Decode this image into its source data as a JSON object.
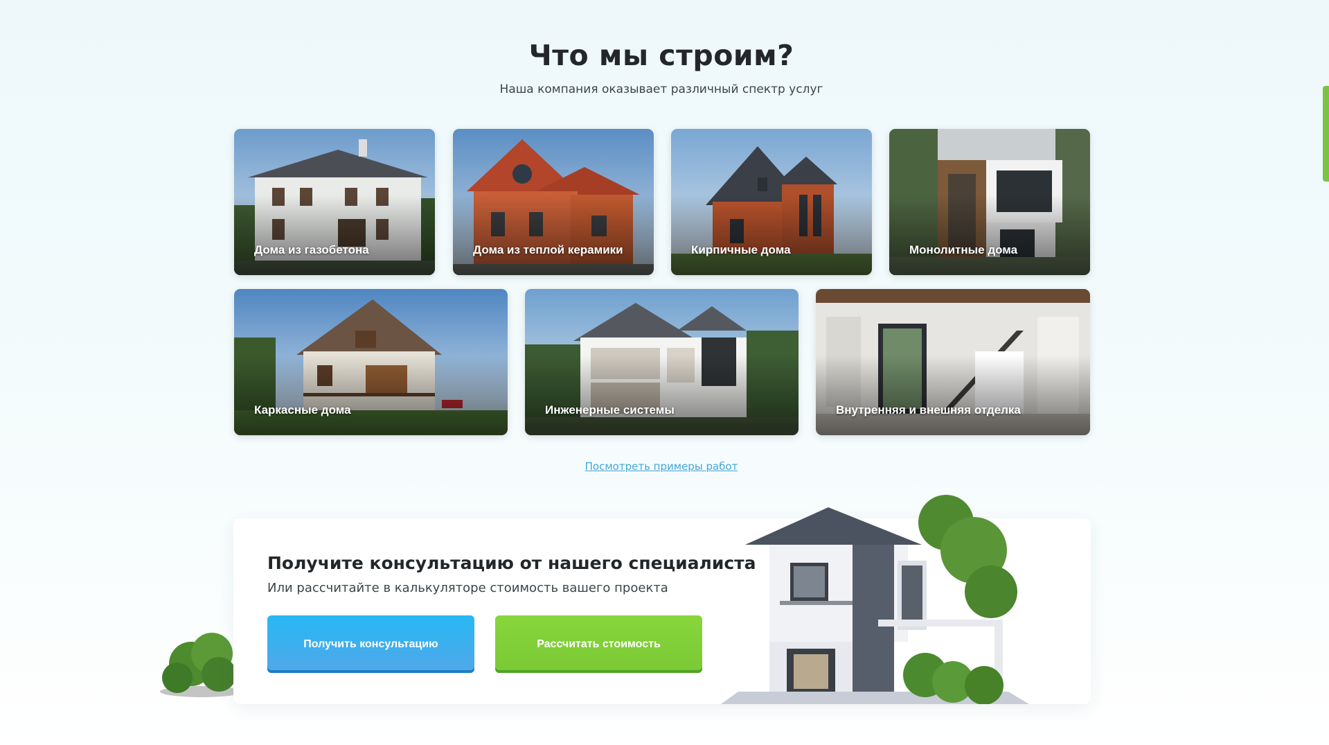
{
  "section": {
    "title": "Что мы строим?",
    "subtitle": "Наша компания оказывает различный спектр услуг"
  },
  "cards": [
    {
      "label": "Дома из газобетона"
    },
    {
      "label": "Дома из теплой керамики"
    },
    {
      "label": "Кирпичные дома"
    },
    {
      "label": "Монолитные дома"
    },
    {
      "label": "Каркасные дома"
    },
    {
      "label": "Инженерные системы"
    },
    {
      "label": "Внутренняя и внешняя отделка"
    }
  ],
  "examples_link": "Посмотреть примеры работ",
  "cta": {
    "title": "Получите консультацию от нашего специалиста",
    "subtitle": "Или рассчитайте в калькуляторе стоимость вашего проекта",
    "consult_button": "Получить консультацию",
    "calc_button": "Рассчитать стоимость"
  },
  "colors": {
    "accent_blue": "#27b8f4",
    "accent_green": "#7ac935",
    "link": "#3fa6dc"
  }
}
